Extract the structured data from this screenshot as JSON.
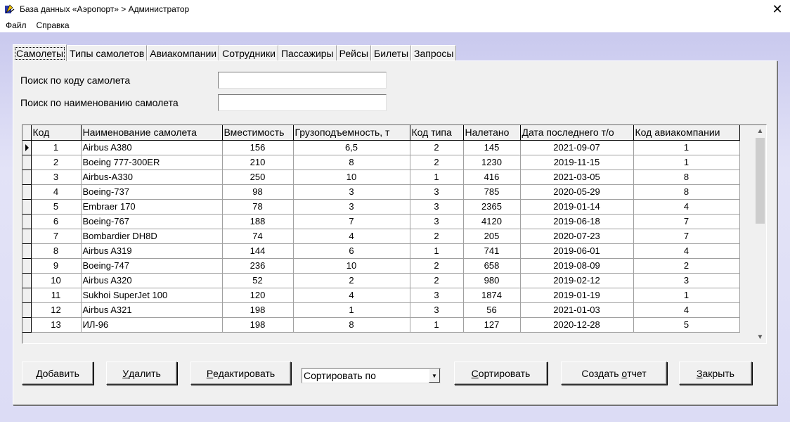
{
  "window": {
    "title": "База данных «Аэропорт» > Администратор",
    "close_glyph": "✕"
  },
  "menu": [
    "Файл",
    "Справка"
  ],
  "tabs": [
    "Самолеты",
    "Типы самолетов",
    "Авиакомпании",
    "Сотрудники",
    "Пассажиры",
    "Рейсы",
    "Билеты",
    "Запросы"
  ],
  "search": {
    "by_code_label": "Поиск по коду самолета",
    "by_name_label": "Поиск по наименованию самолета",
    "by_code_value": "",
    "by_name_value": ""
  },
  "grid": {
    "columns": [
      "Код",
      "Наименование самолета",
      "Вместимость",
      "Грузоподъемность, т",
      "Код типа",
      "Налетано",
      "Дата последнего т/о",
      "Код авиакомпании"
    ],
    "rows": [
      [
        "1",
        "Airbus A380",
        "156",
        "6,5",
        "2",
        "145",
        "2021-09-07",
        "1"
      ],
      [
        "2",
        "Boeing 777-300ER",
        "210",
        "8",
        "2",
        "1230",
        "2019-11-15",
        "1"
      ],
      [
        "3",
        "Airbus-A330",
        "250",
        "10",
        "1",
        "416",
        "2021-03-05",
        "8"
      ],
      [
        "4",
        "Boeing-737",
        "98",
        "3",
        "3",
        "785",
        "2020-05-29",
        "8"
      ],
      [
        "5",
        "Embraer 170",
        "78",
        "3",
        "3",
        "2365",
        "2019-01-14",
        "4"
      ],
      [
        "6",
        "Boeing-767",
        "188",
        "7",
        "3",
        "4120",
        "2019-06-18",
        "7"
      ],
      [
        "7",
        "Bombardier DH8D",
        "74",
        "4",
        "2",
        "205",
        "2020-07-23",
        "7"
      ],
      [
        "8",
        "Airbus A319",
        "144",
        "6",
        "1",
        "741",
        "2019-06-01",
        "4"
      ],
      [
        "9",
        "Boeing-747",
        "236",
        "10",
        "2",
        "658",
        "2019-08-09",
        "2"
      ],
      [
        "10",
        "Airbus A320",
        "52",
        "2",
        "2",
        "980",
        "2019-02-12",
        "3"
      ],
      [
        "11",
        "Sukhoi SuperJet 100",
        "120",
        "4",
        "3",
        "1874",
        "2019-01-19",
        "1"
      ],
      [
        "12",
        "Airbus A321",
        "198",
        "1",
        "3",
        "56",
        "2021-01-03",
        "4"
      ],
      [
        "13",
        "ИЛ-96",
        "198",
        "8",
        "1",
        "127",
        "2020-12-28",
        "5"
      ]
    ]
  },
  "buttons": {
    "add": {
      "hotkey": "Д",
      "rest": "обавить"
    },
    "delete": {
      "hotkey": "У",
      "rest": "далить"
    },
    "edit": {
      "hotkey": "Р",
      "rest": "едактировать"
    },
    "sort": {
      "hotkey": "С",
      "rest": "ортировать"
    },
    "report": {
      "pre": "Создать ",
      "hotkey": "о",
      "rest": "тчет"
    },
    "close": {
      "hotkey": "З",
      "rest": "акрыть"
    }
  },
  "sort_combo": {
    "selected": "Сортировать по"
  },
  "icons": {
    "app": "airport-app-icon",
    "scroll_up": "▲",
    "scroll_down": "▼",
    "combo": "▼"
  }
}
